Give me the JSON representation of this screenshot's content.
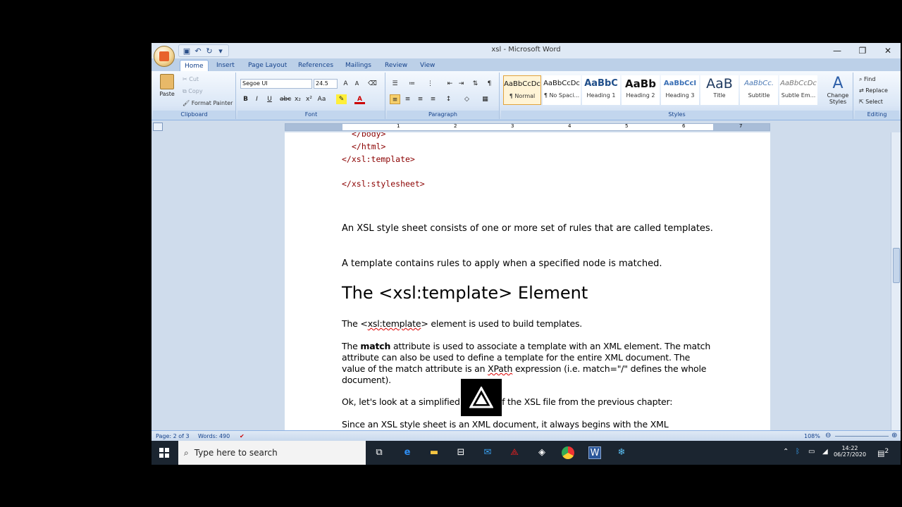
{
  "window": {
    "title": "xsl - Microsoft Word",
    "minimize": "—",
    "restore": "❐",
    "close": "✕"
  },
  "qat": {
    "save": "▣",
    "undo": "↶",
    "redo": "↻",
    "more": "▾"
  },
  "tabs": [
    "Home",
    "Insert",
    "Page Layout",
    "References",
    "Mailings",
    "Review",
    "View"
  ],
  "ribbon": {
    "clipboard": {
      "paste": "Paste",
      "cut": "Cut",
      "copy": "Copy",
      "format_painter": "Format Painter",
      "label": "Clipboard"
    },
    "font": {
      "name": "Segoe UI",
      "size": "24.5",
      "label": "Font"
    },
    "paragraph": {
      "label": "Paragraph"
    },
    "styles": {
      "label": "Styles",
      "items": [
        {
          "preview": "AaBbCcDc",
          "name": "¶ Normal"
        },
        {
          "preview": "AaBbCcDc",
          "name": "¶ No Spaci..."
        },
        {
          "preview": "AaBbC",
          "name": "Heading 1"
        },
        {
          "preview": "AaBb",
          "name": "Heading 2"
        },
        {
          "preview": "AaBbCcI",
          "name": "Heading 3"
        },
        {
          "preview": "AaB",
          "name": "Title"
        },
        {
          "preview": "AaBbCc.",
          "name": "Subtitle"
        },
        {
          "preview": "AaBbCcDc",
          "name": "Subtle Em..."
        }
      ],
      "change_styles": "Change Styles"
    },
    "editing": {
      "find": "Find",
      "replace": "Replace",
      "select": "Select",
      "label": "Editing"
    }
  },
  "ruler": {
    "ticks": [
      "1",
      "2",
      "3",
      "4",
      "5",
      "6",
      "7"
    ]
  },
  "document": {
    "code_lines": [
      "</body>",
      "</html>",
      "</xsl:template>",
      "</xsl:stylesheet>"
    ],
    "para1": "An XSL style sheet consists of one or more set of rules that are called templates.",
    "para2": "A template contains rules to apply when a specified node is matched.",
    "heading": "The <xsl:template> Element",
    "para3_pre": "The <",
    "para3_tag": "xsl:template",
    "para3_post": "> element is used to build templates.",
    "para4_pre": "The ",
    "para4_bold": "match",
    "para4_mid": " attribute is used to associate a template with an XML element. The match attribute can also be used to define a template for the entire XML document. The value of the match attribute is an ",
    "para4_xpath": "XPath",
    "para4_post": " expression (i.e. match=\"/\" defines the whole document).",
    "para5": "Ok, let's look at a simplified version of the XSL file from the previous chapter:",
    "para6": "Since an XSL style sheet is an XML document, it always begins with the XML"
  },
  "status": {
    "page": "Page: 2 of 3",
    "words": "Words: 490",
    "zoom": "108%"
  },
  "taskbar": {
    "search_placeholder": "Type here to search",
    "time": "14:22",
    "date": "06/27/2020",
    "notifications": "2"
  }
}
